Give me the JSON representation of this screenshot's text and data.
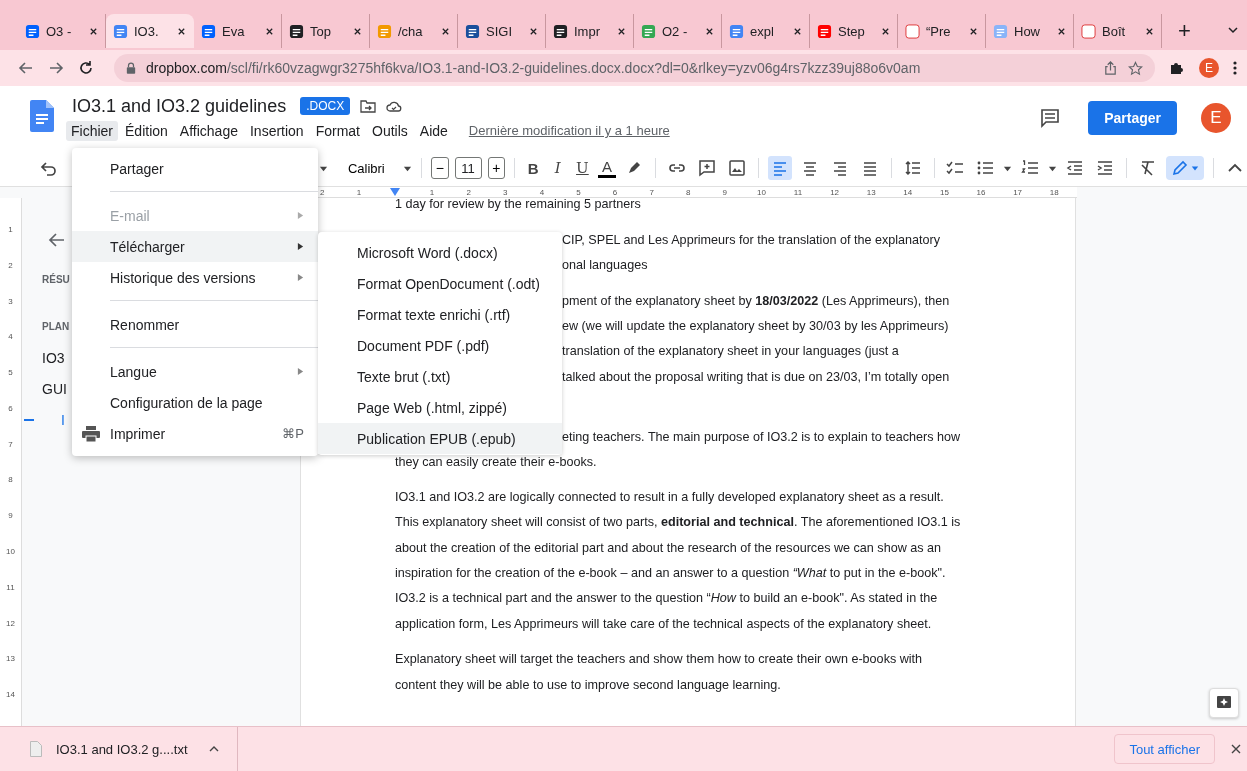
{
  "browser": {
    "tabs": [
      {
        "label": "O3 -",
        "selected": false
      },
      {
        "label": "IO3.",
        "selected": true
      },
      {
        "label": "Eva",
        "selected": false
      },
      {
        "label": "Top",
        "selected": false
      },
      {
        "label": "/cha",
        "selected": false
      },
      {
        "label": "SIGI",
        "selected": false
      },
      {
        "label": "Impr",
        "selected": false
      },
      {
        "label": "O2 -",
        "selected": false
      },
      {
        "label": "expl",
        "selected": false
      },
      {
        "label": "Step",
        "selected": false
      },
      {
        "label": "“Pre",
        "selected": false
      },
      {
        "label": "How",
        "selected": false
      },
      {
        "label": "Boît",
        "selected": false
      }
    ],
    "new_tab": "+",
    "url_host": "dropbox.com",
    "url_path": "/scl/fi/rk60vzagwgr3275hf6kva/IO3.1-and-IO3.2-guidelines.docx.docx?dl=0&rlkey=yzv06g4rs7kzz39uj88o6v0am",
    "profile": "E"
  },
  "doc": {
    "title": "IO3.1 and IO3.2 guidelines",
    "badge": ".DOCX",
    "menu": [
      {
        "label": "Fichier",
        "selected": true
      },
      {
        "label": "Édition",
        "selected": false
      },
      {
        "label": "Affichage",
        "selected": false
      },
      {
        "label": "Insertion",
        "selected": false
      },
      {
        "label": "Format",
        "selected": false
      },
      {
        "label": "Outils",
        "selected": false
      },
      {
        "label": "Aide",
        "selected": false
      }
    ],
    "last_edit": "Dernière modification il y a 1 heure",
    "share": "Partager",
    "avatar": "E"
  },
  "toolbar": {
    "font": "Calibri",
    "size_minus": "−",
    "font_size": "11",
    "size_plus": "+",
    "format": [
      {
        "label": "B",
        "kind": "bold"
      },
      {
        "label": "I",
        "kind": "italic"
      },
      {
        "label": "U",
        "kind": "underline"
      },
      {
        "label": "A",
        "kind": "color"
      }
    ],
    "align": [
      {
        "selected": true
      },
      {
        "selected": false
      },
      {
        "selected": false
      },
      {
        "selected": false
      }
    ],
    "pen": {
      "selected": true
    }
  },
  "ruler": {
    "h": [
      "2",
      "1",
      "1",
      "2",
      "3",
      "4",
      "5",
      "6",
      "7",
      "8",
      "9",
      "10",
      "11",
      "12",
      "13",
      "14",
      "15",
      "16",
      "17",
      "18"
    ],
    "v": [
      "1",
      "2",
      "3",
      "4",
      "5",
      "6",
      "7",
      "8",
      "9",
      "10",
      "11",
      "12",
      "13",
      "14"
    ]
  },
  "outline": [
    {
      "text": "RÉSU",
      "kind": "heading"
    },
    {
      "text": "PLAN",
      "kind": "heading"
    },
    {
      "text": "IO3",
      "kind": "item"
    },
    {
      "text": "GUI",
      "kind": "item"
    },
    {
      "text": "I",
      "kind": "current"
    }
  ],
  "file_menu": [
    {
      "kind": "item",
      "label": "Partager",
      "disabled": false,
      "selected": false
    },
    {
      "kind": "divider"
    },
    {
      "kind": "item",
      "label": "E-mail",
      "disabled": true,
      "selected": false,
      "submenu": true
    },
    {
      "kind": "item",
      "label": "Télécharger",
      "disabled": false,
      "selected": true,
      "submenu": true
    },
    {
      "kind": "item",
      "label": "Historique des versions",
      "disabled": false,
      "selected": false,
      "submenu": true
    },
    {
      "kind": "divider"
    },
    {
      "kind": "item",
      "label": "Renommer",
      "disabled": false,
      "selected": false
    },
    {
      "kind": "divider"
    },
    {
      "kind": "item",
      "label": "Langue",
      "disabled": false,
      "selected": false,
      "submenu": true
    },
    {
      "kind": "item",
      "label": "Configuration de la page",
      "disabled": false,
      "selected": false
    },
    {
      "kind": "print_item",
      "label": "Imprimer",
      "disabled": false,
      "selected": false,
      "shortcut": "⌘P"
    }
  ],
  "download_menu": [
    {
      "label": "Microsoft Word (.docx)",
      "selected": false
    },
    {
      "label": "Format OpenDocument (.odt)",
      "selected": false
    },
    {
      "label": "Format texte enrichi (.rtf)",
      "selected": false
    },
    {
      "label": "Document PDF (.pdf)",
      "selected": false
    },
    {
      "label": "Texte brut (.txt)",
      "selected": false
    },
    {
      "label": "Page Web (.html, zippé)",
      "selected": false
    },
    {
      "label": "Publication EPUB (.epub)",
      "selected": true
    }
  ],
  "paragraphs": [
    {
      "lines": [
        {
          "text": "1 day for review by the remaining 5 partners",
          "clipped": false
        }
      ]
    },
    {
      "lines": [
        {
          "text": "CIP, SPEL and Les Apprimeurs for the translation of the explanatory",
          "clipped": true
        },
        {
          "text": "onal languages",
          "clipped": true
        }
      ]
    },
    {
      "lines": [
        {
          "text": "pment of the explanatory sheet by **18/03/2022** (Les Apprimeurs), then",
          "clipped": true
        },
        {
          "text": "ew (we will update the explanatory sheet by 30/03 by les Apprimeurs)",
          "clipped": true
        },
        {
          "text": "translation of the explanatory sheet in your languages (just a",
          "clipped": true
        },
        {
          "text": "talked about the proposal writing that is due on 23/03, I’m totally open",
          "clipped": true
        }
      ]
    },
    {
      "lines": [
        {
          "text": "eting teachers. The main purpose of IO3.2 is to explain to teachers how",
          "clipped": true
        },
        {
          "text": "they can easily create their e-books.",
          "clipped": false
        }
      ]
    },
    {
      "lines": [
        {
          "text": "IO3.1 and IO3.2 are logically connected to result in a fully developed explanatory sheet as a result.",
          "clipped": false
        },
        {
          "text": "This explanatory sheet will consist of two parts, **editorial and technical**. The aforementioned IO3.1 is",
          "clipped": false
        },
        {
          "text": "about the creation of the editorial part and about the research of the resources we can show as an",
          "clipped": false
        },
        {
          "text": "inspiration for the creation of the e-book – and an answer to a question *“What* to put in the e-book\".",
          "clipped": false
        },
        {
          "text": "IO3.2 is a technical part and the answer to the question “*How* to build an e-book\". As stated in the",
          "clipped": false
        },
        {
          "text": "application form, Les Apprimeurs will take care of the technical aspects of the explanatory sheet.",
          "clipped": false
        }
      ]
    },
    {
      "lines": [
        {
          "text": "Explanatory sheet will target the teachers and show them how to create their own e-books with",
          "clipped": false
        },
        {
          "text": "content they will be able to use to improve second language learning.",
          "clipped": false
        }
      ]
    }
  ],
  "downloads": {
    "file": "IO3.1 and IO3.2 g....txt",
    "show_all": "Tout afficher"
  }
}
